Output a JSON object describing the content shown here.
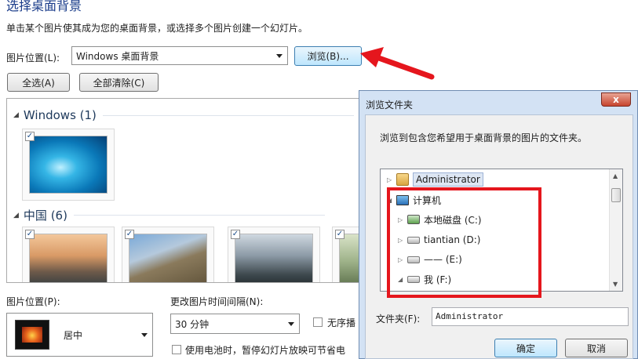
{
  "header": {
    "title": "选择桌面背景",
    "subtitle": "单击某个图片使其成为您的桌面背景，或选择多个图片创建一个幻灯片。"
  },
  "location": {
    "label": "图片位置(L):",
    "value": "Windows 桌面背景",
    "browse_label": "浏览(B)..."
  },
  "actions": {
    "select_all": "全选(A)",
    "clear_all": "全部清除(C)"
  },
  "gallery": {
    "groups": [
      {
        "label": "Windows (1)"
      },
      {
        "label": "中国 (6)"
      }
    ]
  },
  "bottom": {
    "position_label": "图片位置(P):",
    "position_value": "居中",
    "interval_label": "更改图片时间间隔(N):",
    "interval_value": "30 分钟",
    "shuffle_label": "无序播",
    "battery_label": "使用电池时，暂停幻灯片放映可节省电"
  },
  "dialog": {
    "title": "浏览文件夹",
    "close": "x",
    "instruction": "浏览到包含您希望用于桌面背景的图片的文件夹。",
    "tree": [
      {
        "label": "Administrator",
        "icon": "user-folder-icon",
        "expander": "▷"
      },
      {
        "label": "计算机",
        "icon": "computer-icon",
        "expander": "◢"
      },
      {
        "label": "本地磁盘 (C:)",
        "icon": "local-disk-icon",
        "expander": "▷"
      },
      {
        "label": "tiantian (D:)",
        "icon": "drive-icon",
        "expander": "▷"
      },
      {
        "label": "—— (E:)",
        "icon": "drive-icon",
        "expander": "▷"
      },
      {
        "label": "我 (F:)",
        "icon": "drive-icon",
        "expander": "◢"
      }
    ],
    "folder_label": "文件夹(F):",
    "folder_value": "Administrator",
    "ok_label": "确定",
    "cancel_label": "取消"
  },
  "annotations": {
    "highlight_color": "#e5161d"
  }
}
